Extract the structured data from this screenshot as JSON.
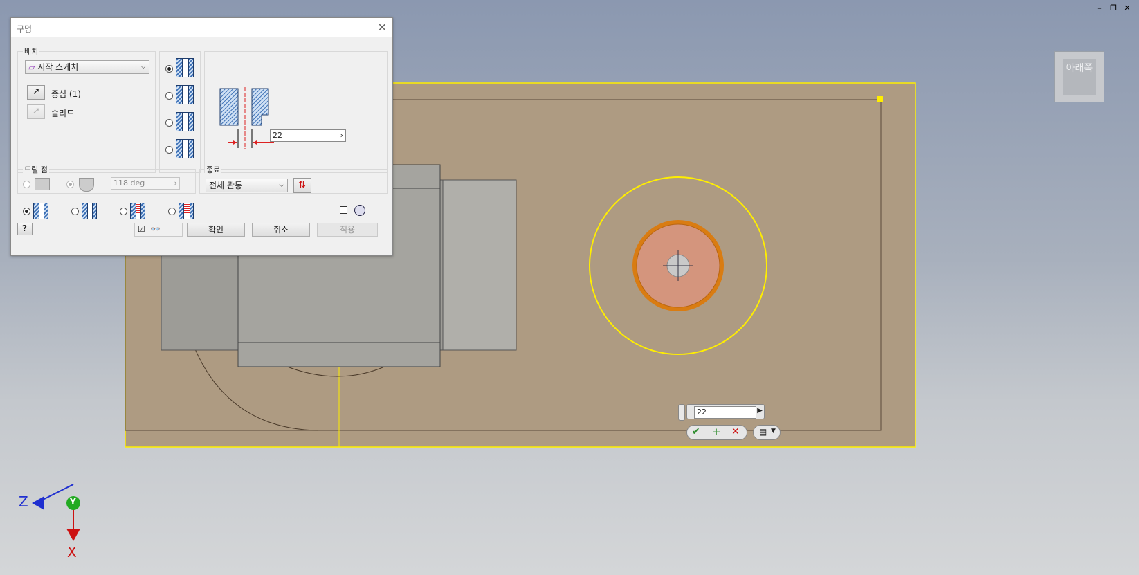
{
  "window": {
    "minimize_label": "–",
    "restore_label": "❐",
    "close_label": "✕"
  },
  "viewcube": {
    "label": "아래쪽"
  },
  "dialog": {
    "title": "구멍",
    "placement": {
      "group_label": "배치",
      "type_value": "시작 스케치",
      "center_label": "중심 (1)",
      "solid_label": "솔리드"
    },
    "diameter_value": "22",
    "drill_point": {
      "group_label": "드릴 점",
      "angle_value": "118 deg"
    },
    "termination": {
      "group_label": "종료",
      "value": "전체 관통"
    },
    "buttons": {
      "ok": "확인",
      "cancel": "취소",
      "apply": "적용"
    }
  },
  "minitoolbar": {
    "diameter_value": "22"
  },
  "axes": {
    "z_label": "Z",
    "y_label": "Y",
    "x_label": "X"
  },
  "colors": {
    "face": "#ae9b82",
    "highlight": "#ffee00",
    "hole_fill": "#d4957d",
    "hole_ring": "#d97c12",
    "z_axis": "#1f2fd0",
    "y_axis": "#22aa22",
    "x_axis": "#cc1111"
  }
}
